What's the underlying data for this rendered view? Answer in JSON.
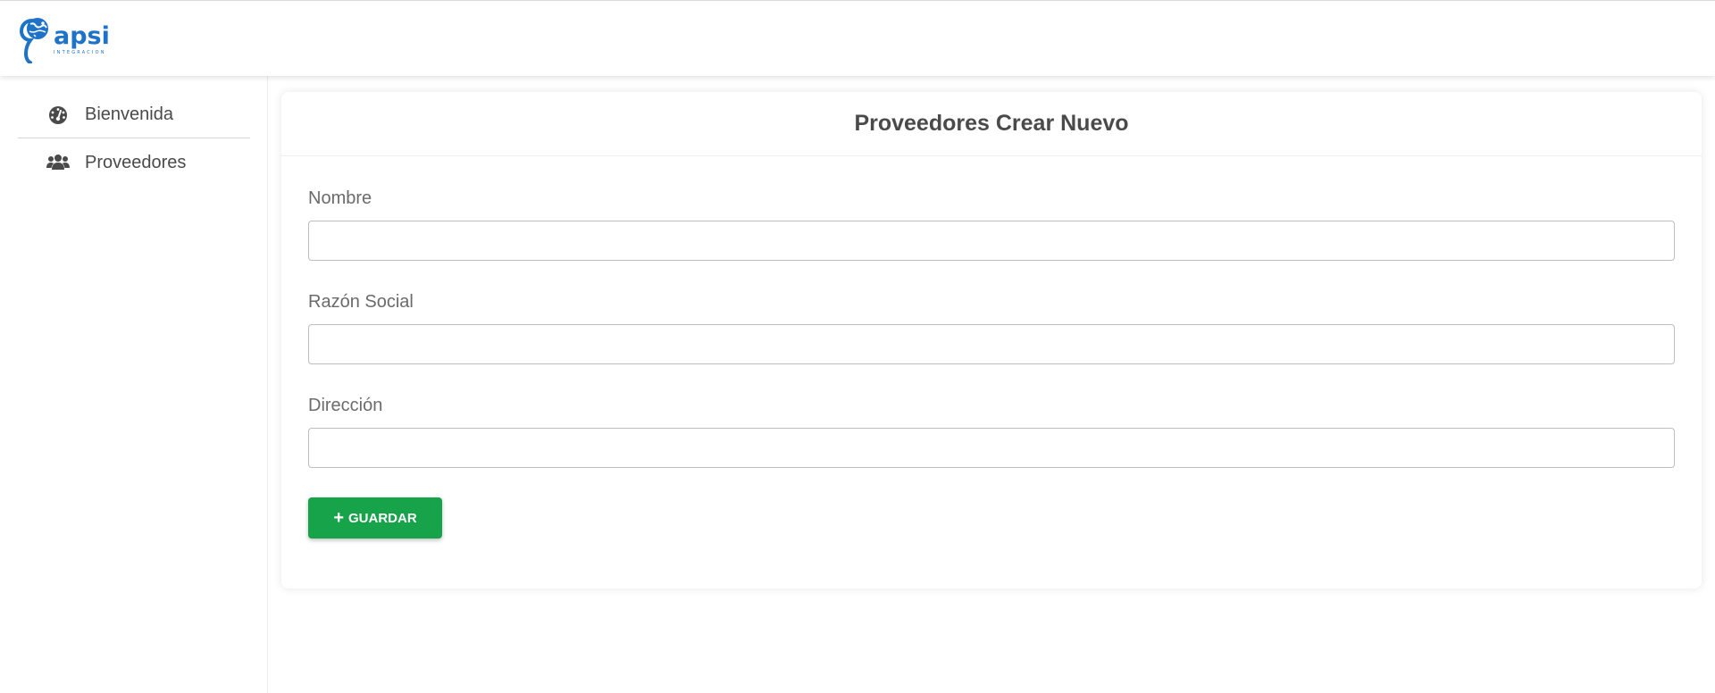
{
  "header": {
    "logo_text": "apsi",
    "logo_subtext": "INTEGRACION",
    "brand_color": "#1e73c8"
  },
  "sidebar": {
    "items": [
      {
        "label": "Bienvenida",
        "icon": "dashboard-gauge-icon"
      },
      {
        "label": "Proveedores",
        "icon": "users-icon"
      }
    ]
  },
  "main": {
    "title": "Proveedores Crear Nuevo",
    "fields": [
      {
        "label": "Nombre",
        "value": "",
        "placeholder": ""
      },
      {
        "label": "Razón Social",
        "value": "",
        "placeholder": ""
      },
      {
        "label": "Dirección",
        "value": "",
        "placeholder": ""
      }
    ],
    "save_button": {
      "label": "GUARDAR",
      "icon": "plus-icon",
      "color": "#17a34a"
    }
  }
}
